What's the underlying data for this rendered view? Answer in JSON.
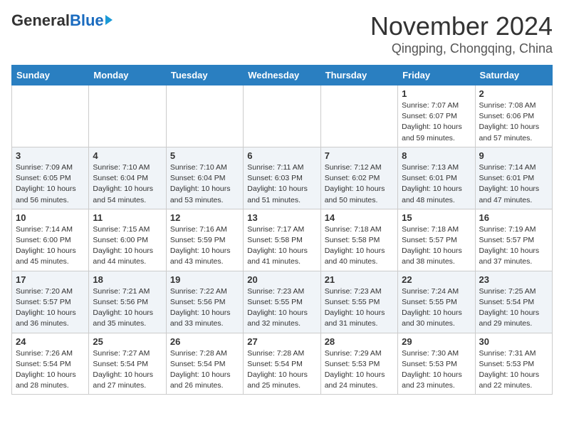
{
  "header": {
    "logo_general": "General",
    "logo_blue": "Blue",
    "month_title": "November 2024",
    "location": "Qingping, Chongqing, China"
  },
  "weekdays": [
    "Sunday",
    "Monday",
    "Tuesday",
    "Wednesday",
    "Thursday",
    "Friday",
    "Saturday"
  ],
  "weeks": [
    [
      {
        "day": "",
        "detail": ""
      },
      {
        "day": "",
        "detail": ""
      },
      {
        "day": "",
        "detail": ""
      },
      {
        "day": "",
        "detail": ""
      },
      {
        "day": "",
        "detail": ""
      },
      {
        "day": "1",
        "detail": "Sunrise: 7:07 AM\nSunset: 6:07 PM\nDaylight: 10 hours and 59 minutes."
      },
      {
        "day": "2",
        "detail": "Sunrise: 7:08 AM\nSunset: 6:06 PM\nDaylight: 10 hours and 57 minutes."
      }
    ],
    [
      {
        "day": "3",
        "detail": "Sunrise: 7:09 AM\nSunset: 6:05 PM\nDaylight: 10 hours and 56 minutes."
      },
      {
        "day": "4",
        "detail": "Sunrise: 7:10 AM\nSunset: 6:04 PM\nDaylight: 10 hours and 54 minutes."
      },
      {
        "day": "5",
        "detail": "Sunrise: 7:10 AM\nSunset: 6:04 PM\nDaylight: 10 hours and 53 minutes."
      },
      {
        "day": "6",
        "detail": "Sunrise: 7:11 AM\nSunset: 6:03 PM\nDaylight: 10 hours and 51 minutes."
      },
      {
        "day": "7",
        "detail": "Sunrise: 7:12 AM\nSunset: 6:02 PM\nDaylight: 10 hours and 50 minutes."
      },
      {
        "day": "8",
        "detail": "Sunrise: 7:13 AM\nSunset: 6:01 PM\nDaylight: 10 hours and 48 minutes."
      },
      {
        "day": "9",
        "detail": "Sunrise: 7:14 AM\nSunset: 6:01 PM\nDaylight: 10 hours and 47 minutes."
      }
    ],
    [
      {
        "day": "10",
        "detail": "Sunrise: 7:14 AM\nSunset: 6:00 PM\nDaylight: 10 hours and 45 minutes."
      },
      {
        "day": "11",
        "detail": "Sunrise: 7:15 AM\nSunset: 6:00 PM\nDaylight: 10 hours and 44 minutes."
      },
      {
        "day": "12",
        "detail": "Sunrise: 7:16 AM\nSunset: 5:59 PM\nDaylight: 10 hours and 43 minutes."
      },
      {
        "day": "13",
        "detail": "Sunrise: 7:17 AM\nSunset: 5:58 PM\nDaylight: 10 hours and 41 minutes."
      },
      {
        "day": "14",
        "detail": "Sunrise: 7:18 AM\nSunset: 5:58 PM\nDaylight: 10 hours and 40 minutes."
      },
      {
        "day": "15",
        "detail": "Sunrise: 7:18 AM\nSunset: 5:57 PM\nDaylight: 10 hours and 38 minutes."
      },
      {
        "day": "16",
        "detail": "Sunrise: 7:19 AM\nSunset: 5:57 PM\nDaylight: 10 hours and 37 minutes."
      }
    ],
    [
      {
        "day": "17",
        "detail": "Sunrise: 7:20 AM\nSunset: 5:57 PM\nDaylight: 10 hours and 36 minutes."
      },
      {
        "day": "18",
        "detail": "Sunrise: 7:21 AM\nSunset: 5:56 PM\nDaylight: 10 hours and 35 minutes."
      },
      {
        "day": "19",
        "detail": "Sunrise: 7:22 AM\nSunset: 5:56 PM\nDaylight: 10 hours and 33 minutes."
      },
      {
        "day": "20",
        "detail": "Sunrise: 7:23 AM\nSunset: 5:55 PM\nDaylight: 10 hours and 32 minutes."
      },
      {
        "day": "21",
        "detail": "Sunrise: 7:23 AM\nSunset: 5:55 PM\nDaylight: 10 hours and 31 minutes."
      },
      {
        "day": "22",
        "detail": "Sunrise: 7:24 AM\nSunset: 5:55 PM\nDaylight: 10 hours and 30 minutes."
      },
      {
        "day": "23",
        "detail": "Sunrise: 7:25 AM\nSunset: 5:54 PM\nDaylight: 10 hours and 29 minutes."
      }
    ],
    [
      {
        "day": "24",
        "detail": "Sunrise: 7:26 AM\nSunset: 5:54 PM\nDaylight: 10 hours and 28 minutes."
      },
      {
        "day": "25",
        "detail": "Sunrise: 7:27 AM\nSunset: 5:54 PM\nDaylight: 10 hours and 27 minutes."
      },
      {
        "day": "26",
        "detail": "Sunrise: 7:28 AM\nSunset: 5:54 PM\nDaylight: 10 hours and 26 minutes."
      },
      {
        "day": "27",
        "detail": "Sunrise: 7:28 AM\nSunset: 5:54 PM\nDaylight: 10 hours and 25 minutes."
      },
      {
        "day": "28",
        "detail": "Sunrise: 7:29 AM\nSunset: 5:53 PM\nDaylight: 10 hours and 24 minutes."
      },
      {
        "day": "29",
        "detail": "Sunrise: 7:30 AM\nSunset: 5:53 PM\nDaylight: 10 hours and 23 minutes."
      },
      {
        "day": "30",
        "detail": "Sunrise: 7:31 AM\nSunset: 5:53 PM\nDaylight: 10 hours and 22 minutes."
      }
    ]
  ]
}
